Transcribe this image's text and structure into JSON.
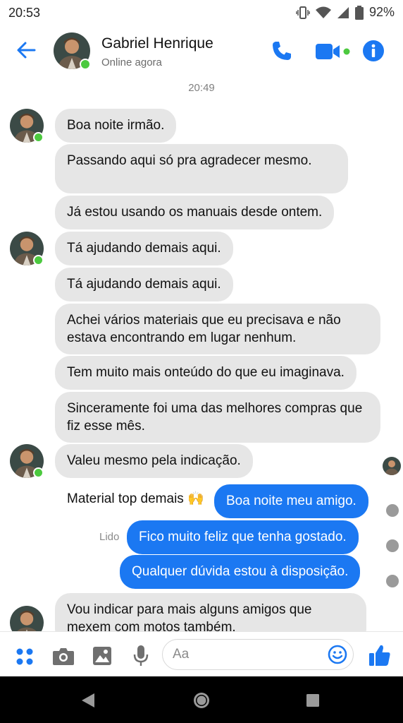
{
  "status_bar": {
    "time": "20:53",
    "battery": "92%"
  },
  "header": {
    "name": "Gabriel Henrique",
    "status": "Online agora"
  },
  "chat": {
    "timestamp": "20:49",
    "messages": [
      {
        "text": "Boa noite irmão."
      },
      {
        "text": "Passando aqui só pra agradecer mesmo."
      },
      {
        "text": "Já estou usando os manuais desde ontem."
      },
      {
        "text": "Tá ajudando demais aqui."
      },
      {
        "text": "Tá ajudando demais aqui."
      },
      {
        "text": "Achei vários materiais que eu precisava e não estava encontrando em lugar nenhum."
      },
      {
        "text": "Tem muito mais onteúdo do que eu imaginava."
      },
      {
        "text": "Sinceramente foi uma das melhores compras que fiz esse mês."
      },
      {
        "text": "Valeu mesmo pela indicação."
      },
      {
        "text": "Material top demais 🙌"
      },
      {
        "text": "Boa noite meu amigo."
      },
      {
        "text": "Fico muito feliz que tenha gostado."
      },
      {
        "text": "Qualquer dúvida estou à disposição."
      },
      {
        "text": "Vou indicar para mais alguns amigos que mexem com motos também."
      }
    ],
    "read_label": "Lido"
  },
  "composer": {
    "placeholder": "Aa"
  },
  "colors": {
    "accent": "#1b78f2",
    "incoming_bubble": "#e6e6e6",
    "online": "#4cc93f"
  }
}
